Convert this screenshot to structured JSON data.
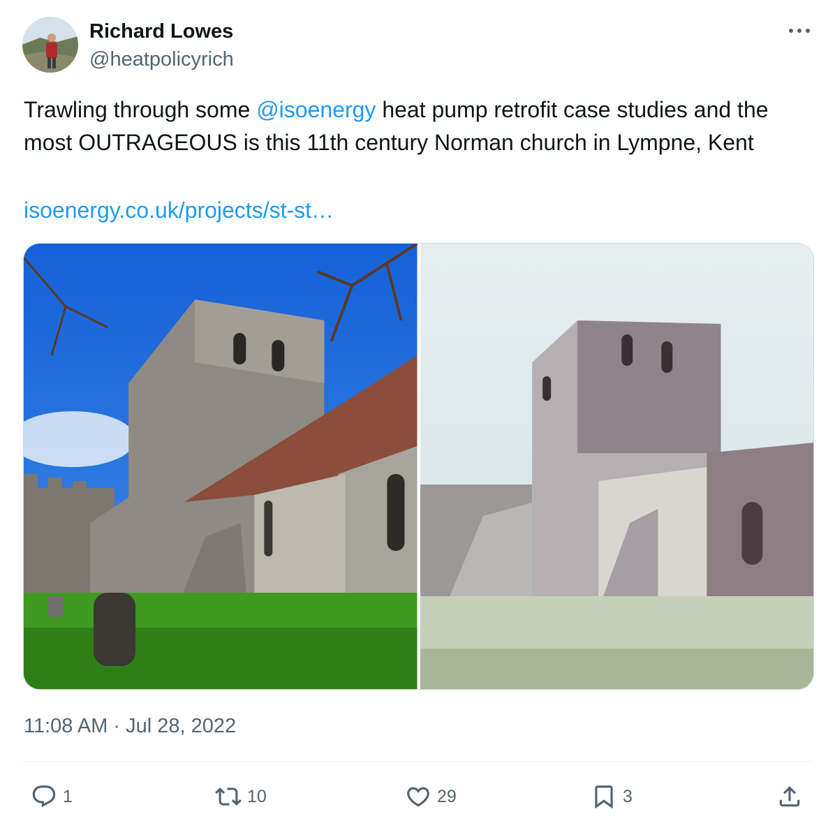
{
  "author": {
    "name": "Richard Lowes",
    "handle": "@heatpolicyrich"
  },
  "tweet": {
    "text_before": "Trawling through some ",
    "mention": "@isoenergy",
    "text_after": " heat pump retrofit case studies and the most OUTRAGEOUS is this 11th century Norman church in Lympne, Kent",
    "link": "isoenergy.co.uk/projects/st-st…",
    "timestamp": "11:08 AM · Jul 28, 2022"
  },
  "actions": {
    "replies": "1",
    "retweets": "10",
    "likes": "29",
    "bookmarks": "3"
  },
  "icons": {
    "more": "more-icon",
    "reply": "reply-icon",
    "retweet": "retweet-icon",
    "like": "heart-icon",
    "bookmark": "bookmark-icon",
    "share": "share-icon"
  },
  "colors": {
    "text": "#0f1419",
    "secondary": "#536471",
    "link": "#1d9bf0",
    "divider": "#eff3f4"
  }
}
